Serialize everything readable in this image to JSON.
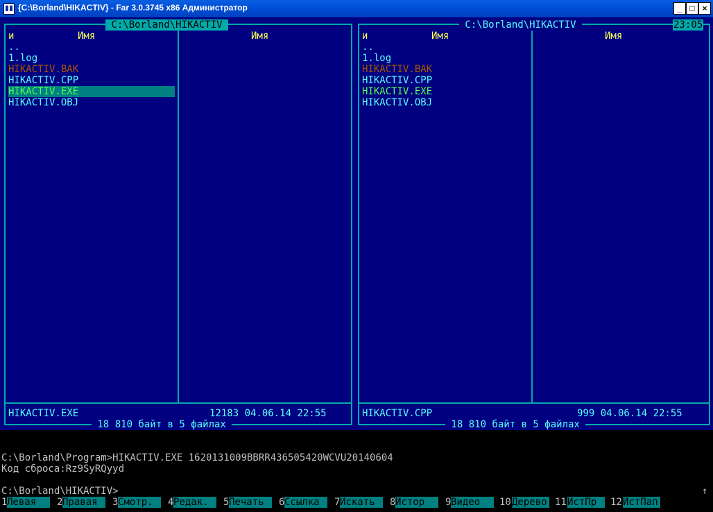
{
  "window": {
    "title": "{C:\\Borland\\HIKACTIV} - Far 3.0.3745 x86 Администратор",
    "buttons": [
      "_",
      "□",
      "×"
    ]
  },
  "left_panel": {
    "path": " C:\\Borland\\HIKACTIV ",
    "col_n": "и",
    "col_name_1": "Имя",
    "col_name_2": "Имя",
    "files": [
      {
        "name": "..",
        "color": "cyan"
      },
      {
        "name": "1.log",
        "color": "cyan"
      },
      {
        "name": "HIKACTIV.BAK",
        "color": "brown"
      },
      {
        "name": "HIKACTIV.CPP",
        "color": "cyan"
      },
      {
        "name": "HIKACTIV.EXE",
        "color": "green",
        "selected": true
      },
      {
        "name": "HIKACTIV.OBJ",
        "color": "cyan"
      }
    ],
    "status_name": "HIKACTIV.EXE",
    "status_info": "12183 04.06.14 22:55",
    "summary": " 18 810 байт в 5 файлах "
  },
  "right_panel": {
    "path": " C:\\Borland\\HIKACTIV ",
    "clock": "23:05",
    "col_n": "и",
    "col_name_1": "Имя",
    "col_name_2": "Имя",
    "files": [
      {
        "name": "..",
        "color": "cyan"
      },
      {
        "name": "1.log",
        "color": "cyan"
      },
      {
        "name": "HIKACTIV.BAK",
        "color": "brown"
      },
      {
        "name": "HIKACTIV.CPP",
        "color": "cyan"
      },
      {
        "name": "HIKACTIV.EXE",
        "color": "green"
      },
      {
        "name": "HIKACTIV.OBJ",
        "color": "cyan"
      }
    ],
    "status_name": "HIKACTIV.CPP",
    "status_info": "999 04.06.14 22:55",
    "summary": " 18 810 байт в 5 файлах "
  },
  "console": {
    "lines": [
      "C:\\Borland\\Program>HIKACTIV.EXE 1620131009BBRR436505420WCVU20140604",
      "Код сброса:Rz9SyRQyyd",
      "",
      "C:\\Borland\\HIKACTIV>"
    ],
    "scroll_arrow": "↑"
  },
  "keybar": [
    {
      "n": "1",
      "label": "Левая"
    },
    {
      "n": "2",
      "label": "Правая"
    },
    {
      "n": "3",
      "label": "Смотр."
    },
    {
      "n": "4",
      "label": "Редак."
    },
    {
      "n": "5",
      "label": "Печать"
    },
    {
      "n": "6",
      "label": "Ссылка"
    },
    {
      "n": "7",
      "label": "Искать"
    },
    {
      "n": "8",
      "label": "Истор"
    },
    {
      "n": "9",
      "label": "Видео"
    },
    {
      "n": "10",
      "label": "Дерево"
    },
    {
      "n": "11",
      "label": "ИстПр"
    },
    {
      "n": "12",
      "label": "ИстПап"
    }
  ],
  "colors": {
    "panel_bg": "#000080",
    "frame": "#00aaaa",
    "text_cyan": "#55ffff",
    "text_yellow": "#ffff55",
    "text_brown": "#aa5500",
    "text_green": "#55ff55",
    "selection": "#008080"
  }
}
